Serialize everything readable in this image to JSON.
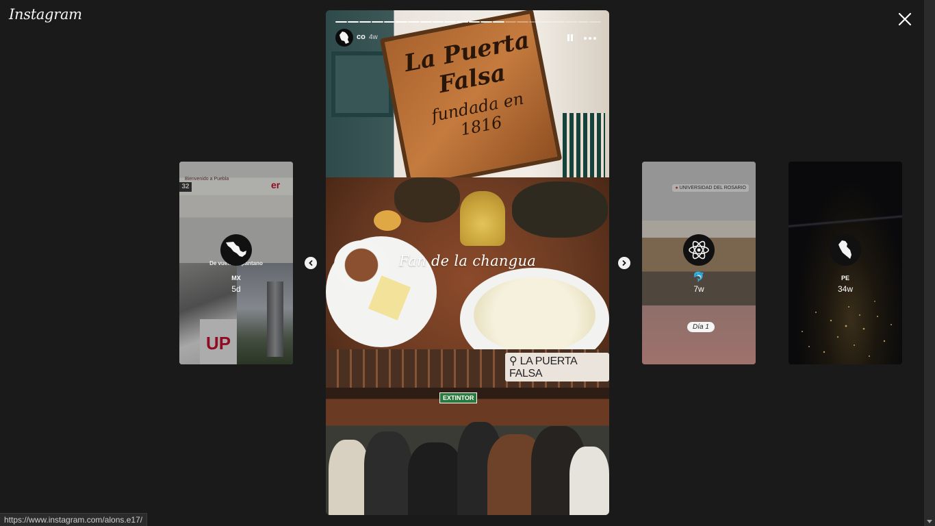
{
  "app": {
    "logo_text": "Instagram"
  },
  "controls": {
    "close_icon": "close-icon",
    "prev_icon": "chevron-left-icon",
    "next_icon": "chevron-right-icon"
  },
  "story": {
    "username": "co",
    "age": "4w",
    "progress_segments_total": 22,
    "progress_segments_done": 14,
    "sign_line1": "La Puerta",
    "sign_line2": "Falsa",
    "sign_line3": "fundada en 1816",
    "caption": "Fan de la changua",
    "location_sticker": "LA PUERTA FALSA",
    "extintor_label": "EXTINTOR",
    "pause_icon": "pause-icon",
    "more_icon": "more-horizontal-icon"
  },
  "previews": [
    {
      "name": "MX",
      "age": "5d",
      "banner": "Bienvenido a Puebla",
      "brand": "er",
      "platform": "32",
      "caption": "De vuelta al pantano",
      "shirt": "UP"
    },
    {
      "name": "🐬",
      "age": "7w",
      "location": "UNIVERSIDAD DEL ROSARIO",
      "sticker": "Día 1"
    },
    {
      "name": "PE",
      "age": "34w"
    }
  ],
  "status_bar": {
    "url": "https://www.instagram.com/alons.e17/"
  }
}
